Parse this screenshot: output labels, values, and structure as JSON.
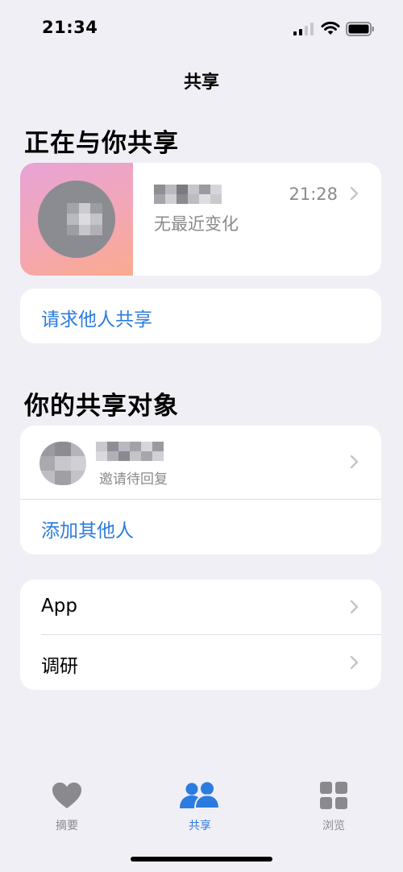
{
  "status": {
    "time": "21:34"
  },
  "nav": {
    "title": "共享"
  },
  "sharing_with_you": {
    "title": "正在与你共享",
    "card": {
      "time": "21:28",
      "subtitle": "无最近变化"
    },
    "request": {
      "label": "请求他人共享"
    }
  },
  "your_shares": {
    "title": "你的共享对象",
    "person": {
      "status": "邀请待回复"
    },
    "add": {
      "label": "添加其他人"
    }
  },
  "more": {
    "items": [
      {
        "label": "App"
      },
      {
        "label": "调研"
      }
    ]
  },
  "tabbar": {
    "tabs": [
      {
        "label": "摘要"
      },
      {
        "label": "共享"
      },
      {
        "label": "浏览"
      }
    ]
  },
  "colors": {
    "accent": "#2c7be0",
    "inactive": "#8a8a8e",
    "background": "#f0eff5"
  }
}
